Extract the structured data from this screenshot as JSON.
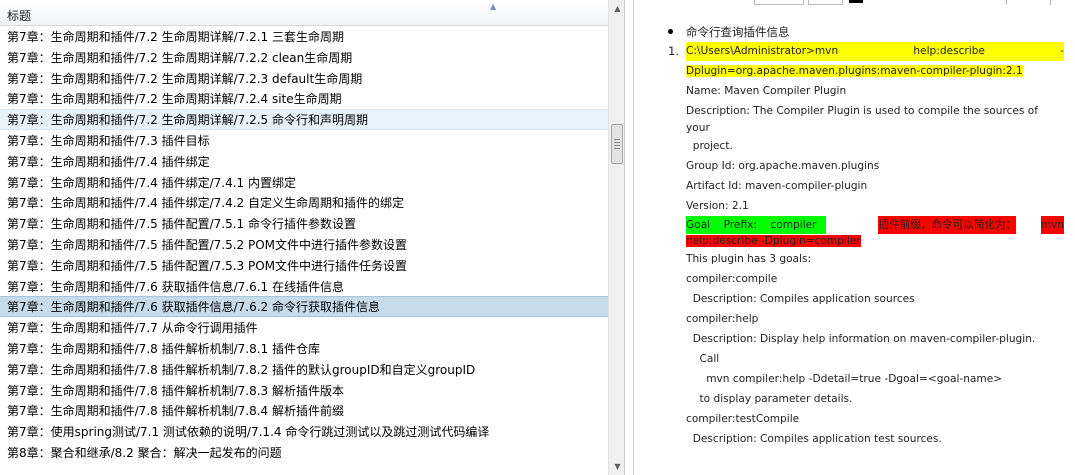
{
  "list": {
    "header": "标题",
    "rows": [
      "第7章：生命周期和插件/7.2 生命周期详解/7.2.1 三套生命周期",
      "第7章：生命周期和插件/7.2 生命周期详解/7.2.2 clean生命周期",
      "第7章：生命周期和插件/7.2 生命周期详解/7.2.3 default生命周期",
      "第7章：生命周期和插件/7.2 生命周期详解/7.2.4 site生命周期",
      "第7章：生命周期和插件/7.2 生命周期详解/7.2.5 命令行和声明周期",
      "第7章：生命周期和插件/7.3 插件目标",
      "第7章：生命周期和插件/7.4 插件绑定",
      "第7章：生命周期和插件/7.4 插件绑定/7.4.1 内置绑定",
      "第7章：生命周期和插件/7.4 插件绑定/7.4.2 自定义生命周期和插件的绑定",
      "第7章：生命周期和插件/7.5 插件配置/7.5.1 命令行插件参数设置",
      "第7章：生命周期和插件/7.5 插件配置/7.5.2 POM文件中进行插件参数设置",
      "第7章：生命周期和插件/7.5 插件配置/7.5.3 POM文件中进行插件任务设置",
      "第7章：生命周期和插件/7.6 获取插件信息/7.6.1 在线插件信息",
      "第7章：生命周期和插件/7.6 获取插件信息/7.6.2 命令行获取插件信息",
      "第7章：生命周期和插件/7.7 从命令行调用插件",
      "第7章：生命周期和插件/7.8 插件解析机制/7.8.1 插件仓库",
      "第7章：生命周期和插件/7.8 插件解析机制/7.8.2 插件的默认groupID和自定义groupID",
      "第7章：生命周期和插件/7.8 插件解析机制/7.8.3 解析插件版本",
      "第7章：生命周期和插件/7.8 插件解析机制/7.8.4 解析插件前缀",
      "第7章：使用spring测试/7.1 测试依赖的说明/7.1.4 命令行跳过测试以及跳过测试代码编译",
      "第8章：聚合和继承/8.2 聚合：解决一起发布的问题"
    ],
    "hover_index": 4,
    "selected_index": 13
  },
  "doc": {
    "bullet": "命令行查询插件信息",
    "num": "1.",
    "cmd_part1": "C:\\Users\\Administrator>mvn",
    "cmd_part2": "help:describe",
    "cmd_part3": "-",
    "cmd_line2": "Dplugin=org.apache.maven.plugins:maven-compiler-plugin:2.1",
    "name": "Name: Maven Compiler Plugin",
    "desc1": "Description: The Compiler Plugin is used to compile the sources of",
    "desc2": "your",
    "desc3": "  project.",
    "group": "Group Id: org.apache.maven.plugins",
    "artifact": "Artifact Id: maven-compiler-plugin",
    "version": "Version: 2.1",
    "goal_prefix": "Goal    Prefix:    compiler",
    "note_part1": "插件前缀，命令可以简化为：",
    "note_part2": "mvn",
    "note_line2": "help:describe -Dplugin=compiler",
    "goals": "This plugin has 3 goals:",
    "g1": "compiler:compile",
    "g1_desc": "  Description: Compiles application sources",
    "g2": "compiler:help",
    "g2_desc": "  Description: Display help information on maven-compiler-plugin.",
    "g2_call": "    Call",
    "g2_cmd": "      mvn compiler:help -Ddetail=true -Dgoal=<goal-name>",
    "g2_tail": "    to display parameter details.",
    "g3": "compiler:testCompile",
    "g3_desc": "  Description: Compiles application test sources."
  }
}
